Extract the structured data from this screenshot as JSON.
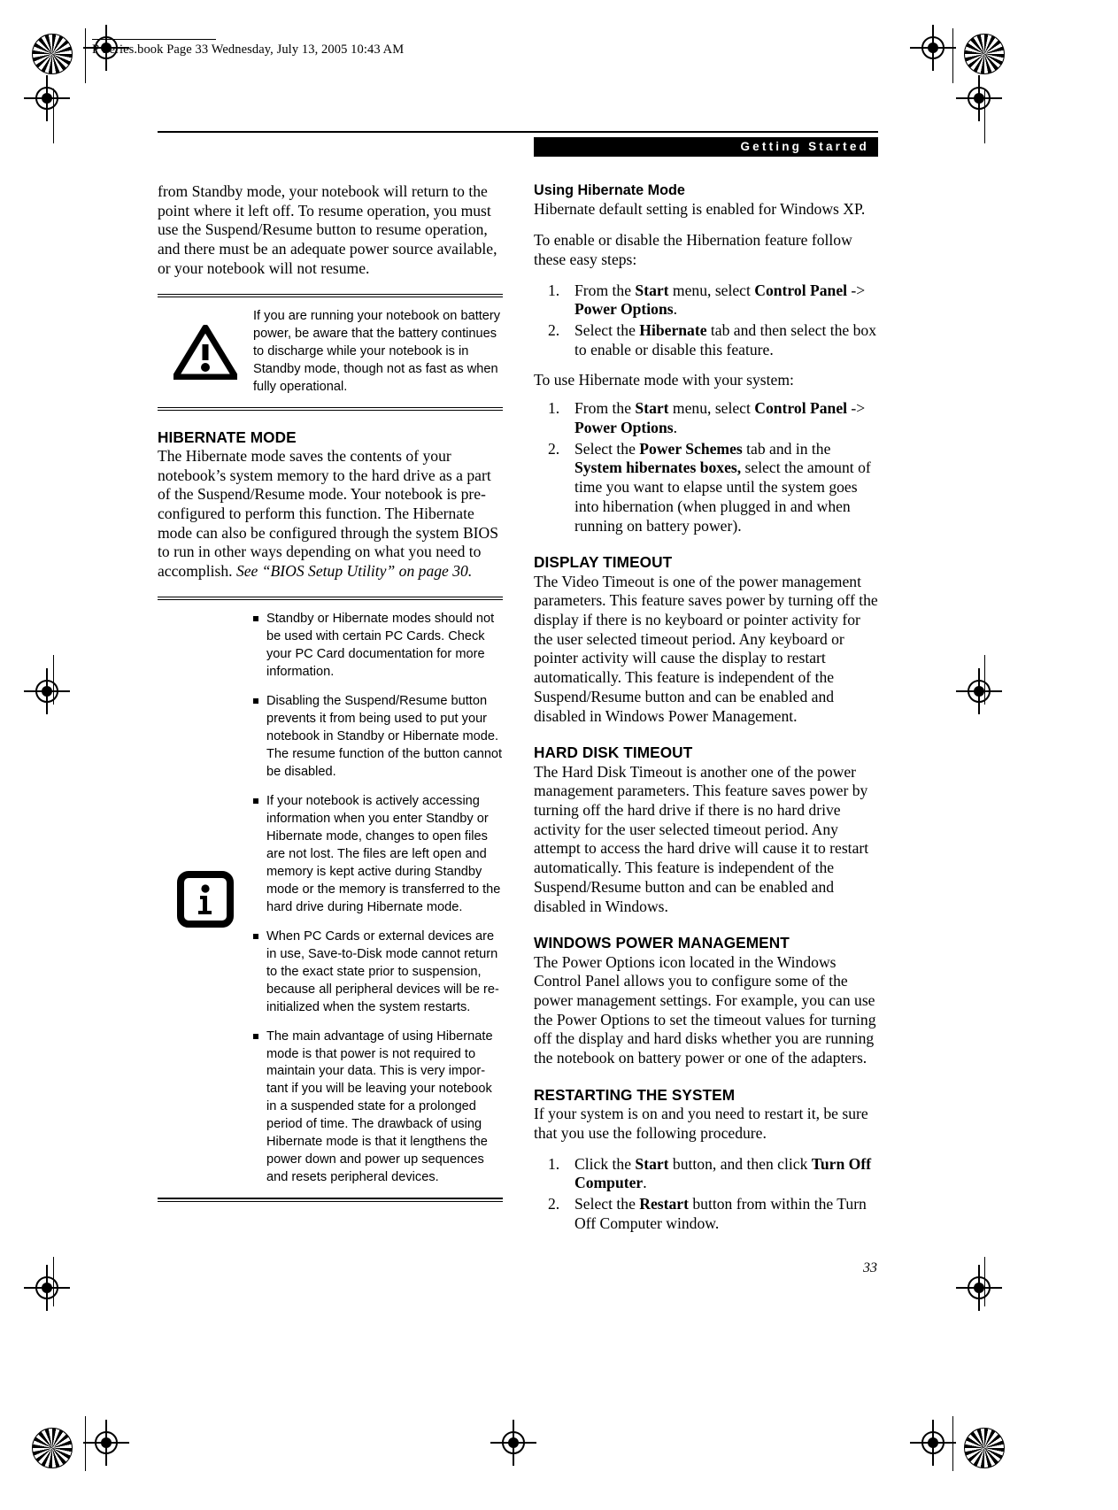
{
  "printstamp": {
    "text": "P Series.book  Page 33  Wednesday, July 13, 2005  10:43 AM"
  },
  "header": {
    "running_head": "Getting Started"
  },
  "page_number": "33",
  "left_column": {
    "continued_paragraph": "from Standby mode, your notebook will return to the point where it left off. To resume operation, you must use the Suspend/Resume button to resume operation, and there must be an adequate power source available, or your notebook will not resume.",
    "caution_box": {
      "icon": "warning-triangle-icon",
      "text": "If you are running your notebook on battery power, be aware that the battery continues to discharge while your notebook is in Standby mode, though not as fast as when fully operational."
    },
    "hibernate_section": {
      "heading": "HIBERNATE MODE",
      "body_1": "The Hibernate mode saves the contents of your notebook’s system memory to the hard drive as a part of the Suspend/Resume mode. Your notebook is pre-configured to perform this function. The Hibernate mode can also be configured through the system BIOS to run in other ways depending on what you need to accomplish. ",
      "body_1_italic": "See “BIOS Setup Utility” on page 30."
    },
    "note_box": {
      "icon": "info-icon",
      "bullets": [
        "Standby or Hibernate modes should not be used with certain PC Cards. Check your PC Card documentation for more information.",
        "Disabling the Suspend/Resume button prevents it from being used to put your notebook in Standby or Hibernate mode. The resume function of the button cannot be disabled.",
        "If your notebook is actively accessing information when you enter Standby or Hibernate mode, changes to open files are not lost. The files are left open and memory is kept active during Standby mode or the memory is transferred to the hard drive during Hibernate mode.",
        "When PC Cards or external devices are in use, Save-to-Disk mode cannot return to the exact state prior to suspension, because all peripheral devices will be re-initialized when the system restarts.",
        "The main advantage of using Hibernate mode is that power is not required to maintain your data. This is very impor-tant if you will be leaving your notebook in a suspended state for a prolonged period of time. The drawback of using Hibernate mode is that it lengthens the power down and power up sequences and resets peripheral devices."
      ]
    }
  },
  "right_column": {
    "using_hibernate": {
      "heading": "Using Hibernate Mode",
      "intro": "Hibernate default setting is enabled for Windows XP.",
      "para_2": "To enable or disable the Hibernation feature follow these easy steps:",
      "steps_1": [
        {
          "num": "1.",
          "pre": "From the ",
          "b1": "Start",
          "mid1": " menu, select ",
          "b2": "Control Panel",
          "mid2": " -> ",
          "b3": "Power Options",
          "post": "."
        },
        {
          "num": "2.",
          "pre": "Select the ",
          "b1": "Hibernate",
          "mid1": " tab and then select the box to enable or disable this feature.",
          "b2": "",
          "mid2": "",
          "b3": "",
          "post": ""
        }
      ],
      "para_3": "To use Hibernate mode with your system:",
      "steps_2": [
        {
          "num": "1.",
          "pre": "From the ",
          "b1": "Start",
          "mid1": " menu, select ",
          "b2": "Control Panel",
          "mid2": " -> ",
          "b3": "Power Options",
          "post": "."
        },
        {
          "num": "2.",
          "pre": "Select the ",
          "b1": "Power Schemes",
          "mid1": " tab and in the ",
          "b2": "System hibernates boxes,",
          "mid2": " select the amount of time you want to elapse until the system goes into hibernation (when plugged in and when running on battery power).",
          "b3": "",
          "post": ""
        }
      ]
    },
    "display_timeout": {
      "heading": "DISPLAY TIMEOUT",
      "body": "The Video Timeout is one of the power management parameters. This feature saves power by turning off the display if there is no keyboard or pointer activity for the user selected timeout period. Any keyboard or pointer activity will cause the display to restart automatically. This feature is independent of the Suspend/Resume button and can be enabled and disabled in Windows Power Management."
    },
    "hard_disk_timeout": {
      "heading": "HARD DISK TIMEOUT",
      "body": "The Hard Disk Timeout is another one of the power management parameters. This feature saves power by turning off the hard drive if there is no hard drive activity for the user selected timeout period. Any attempt to access the hard drive will cause it to restart automatically. This feature is independent of the Suspend/Resume button and can be enabled and disabled in Windows."
    },
    "windows_power_management": {
      "heading": "WINDOWS POWER MANAGEMENT",
      "body": "The Power Options icon located in the Windows Control Panel allows you to configure some of the power management settings. For example, you can use the Power Options to set the timeout values for turning off the display and hard disks whether you are running the notebook on battery power or one of the adapters."
    },
    "restarting_the_system": {
      "heading": "RESTARTING THE SYSTEM",
      "body": "If your system is on and you need to restart it, be sure that you use the following procedure.",
      "steps": [
        {
          "num": "1.",
          "pre": "Click the ",
          "b1": "Start",
          "mid1": " button, and then click ",
          "b2": "Turn Off Computer",
          "mid2": ".",
          "b3": "",
          "post": ""
        },
        {
          "num": "2.",
          "pre": "Select the ",
          "b1": "Restart",
          "mid1": " button from within the Turn Off Computer window.",
          "b2": "",
          "mid2": "",
          "b3": "",
          "post": ""
        }
      ]
    }
  }
}
